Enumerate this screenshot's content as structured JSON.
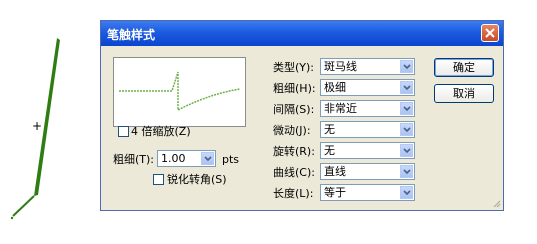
{
  "dialog": {
    "title": "笔触样式",
    "zoom_checkbox_label": "4 倍缩放(Z)",
    "thickness_label": "粗细(T):",
    "thickness_value": "1.00",
    "thickness_unit": "pts",
    "sharpen_checkbox_label": "锐化转角(S)",
    "fields": [
      {
        "label": "类型(Y):",
        "value": "斑马线"
      },
      {
        "label": "粗细(H):",
        "value": "极细"
      },
      {
        "label": "间隔(S):",
        "value": "非常近"
      },
      {
        "label": "微动(J):",
        "value": "无"
      },
      {
        "label": "旋转(R):",
        "value": "无"
      },
      {
        "label": "曲线(C):",
        "value": "直线"
      },
      {
        "label": "长度(L):",
        "value": "等于"
      }
    ],
    "ok_label": "确定",
    "cancel_label": "取消"
  },
  "colors": {
    "stroke_green": "#2e7d12",
    "title_blue": "#1c5be0",
    "dialog_bg": "#ece9d8"
  },
  "icons": [
    "close-icon",
    "chevron-down-icon",
    "crosshair-icon"
  ]
}
